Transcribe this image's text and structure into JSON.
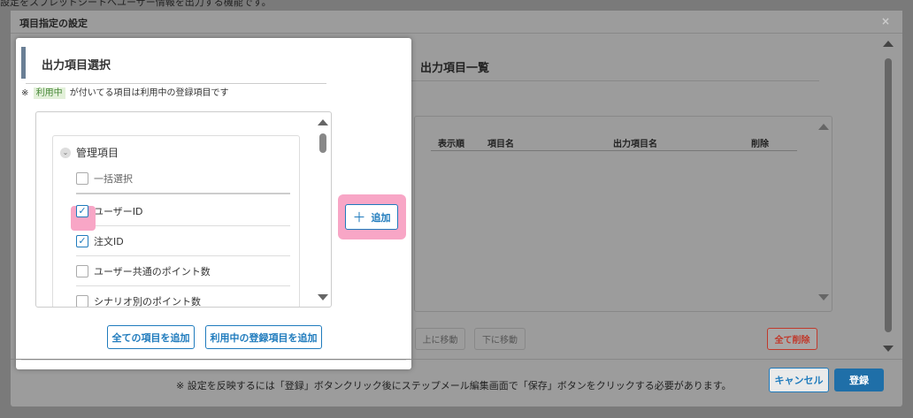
{
  "background_text": "設定をスプレッドシートへユーザー情報を出力する機能です。",
  "dialog": {
    "title": "項目指定の設定",
    "close": "×"
  },
  "left": {
    "title": "出力項目選択",
    "note_prefix": "※",
    "note_badge": "利用中",
    "note_suffix": "が付いてる項目は利用中の登録項目です",
    "group": "管理項目",
    "items": [
      {
        "label": "一括選択",
        "checked": false
      },
      {
        "label": "ユーザーID",
        "checked": true
      },
      {
        "label": "注文ID",
        "checked": true
      },
      {
        "label": "ユーザー共通のポイント数",
        "checked": false
      },
      {
        "label": "シナリオ別のポイント数",
        "checked": false
      }
    ],
    "add_all_label": "全ての項目を追加",
    "add_used_label": "利用中の登録項目を追加"
  },
  "add_button": {
    "icon": "plus-icon",
    "label": "追加"
  },
  "right": {
    "title": "出力項目一覧",
    "columns": [
      "表示順",
      "項目名",
      "出力項目名",
      "削除"
    ],
    "up_label": "上に移動",
    "down_label": "下に移動",
    "delete_all_label": "全て削除"
  },
  "footer": {
    "note": "※ 設定を反映するには「登録」ボタンクリック後にステップメール編集画面で「保存」ボタンをクリックする必要があります。",
    "cancel_label": "キャンセル",
    "save_label": "登録"
  },
  "colors": {
    "accent": "#1f7bbd",
    "highlight": "#f8a6c6",
    "danger": "#c0392b"
  }
}
